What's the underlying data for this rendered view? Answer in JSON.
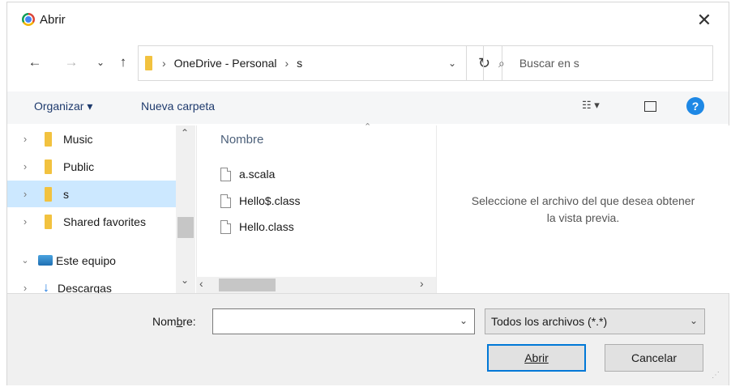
{
  "dialog": {
    "title": "Abrir"
  },
  "nav": {
    "path": [
      "OneDrive - Personal",
      "s"
    ],
    "search_placeholder": "Buscar en s"
  },
  "toolbar": {
    "organize": "Organizar",
    "new_folder": "Nueva carpeta"
  },
  "tree": {
    "items": [
      {
        "label": "Music"
      },
      {
        "label": "Public"
      },
      {
        "label": "s"
      },
      {
        "label": "Shared favorites"
      },
      {
        "label": "Este equipo"
      },
      {
        "label": "Descargas"
      }
    ]
  },
  "files": {
    "column": "Nombre",
    "items": [
      "a.scala",
      "Hello$.class",
      "Hello.class"
    ]
  },
  "preview": {
    "message_line1": "Seleccione el archivo del que desea obtener",
    "message_line2": "la vista previa."
  },
  "bottom": {
    "name_label": "Nombre:",
    "name_value": "",
    "filter": "Todos los archivos (*.*)",
    "open": "Abrir",
    "cancel": "Cancelar"
  },
  "colors": {
    "selected": "#cce8ff",
    "accent": "#0078d7",
    "help": "#1e88e5"
  }
}
